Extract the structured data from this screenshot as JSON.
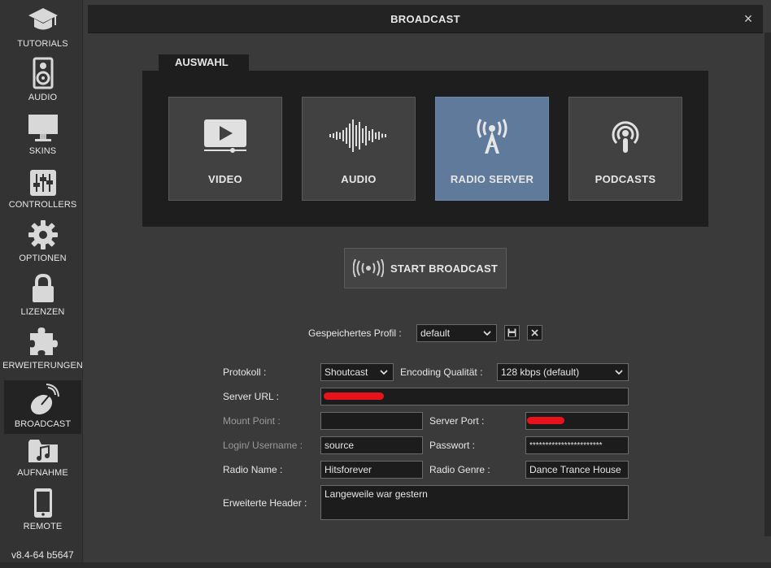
{
  "sidebar": {
    "items": [
      {
        "label": "TUTORIALS",
        "icon": "graduation-cap-icon"
      },
      {
        "label": "AUDIO",
        "icon": "speaker-icon"
      },
      {
        "label": "SKINS",
        "icon": "monitor-icon"
      },
      {
        "label": "CONTROLLERS",
        "icon": "mixer-sliders-icon"
      },
      {
        "label": "OPTIONEN",
        "icon": "gear-icon"
      },
      {
        "label": "LIZENZEN",
        "icon": "lock-icon"
      },
      {
        "label": "ERWEITERUNGEN",
        "icon": "puzzle-icon"
      },
      {
        "label": "BROADCAST",
        "icon": "satellite-dish-icon",
        "active": true
      },
      {
        "label": "AUFNAHME",
        "icon": "music-folder-icon"
      },
      {
        "label": "REMOTE",
        "icon": "phone-icon"
      }
    ],
    "version": "v8.4-64 b5647"
  },
  "dialog": {
    "title": "BROADCAST",
    "close": "×"
  },
  "auswahl": {
    "tab_label": "AUSWAHL",
    "tiles": [
      {
        "label": "VIDEO",
        "icon": "video-play-icon"
      },
      {
        "label": "AUDIO",
        "icon": "waveform-icon"
      },
      {
        "label": "RADIO SERVER",
        "icon": "radio-tower-icon",
        "active": true
      },
      {
        "label": "PODCASTS",
        "icon": "podcast-icon"
      }
    ]
  },
  "start_broadcast": {
    "label": "START BROADCAST",
    "icon": "broadcast-waves-icon"
  },
  "profile": {
    "label": "Gespeichertes Profil :",
    "value": "default",
    "save_icon": "floppy-disk-icon",
    "delete_icon": "close-icon"
  },
  "form": {
    "protokoll_label": "Protokoll :",
    "protokoll_value": "Shoutcast",
    "encoding_label": "Encoding Qualität :",
    "encoding_value": "128 kbps (default)",
    "server_url_label": "Server URL :",
    "server_url_value": "",
    "mount_point_label": "Mount Point :",
    "mount_point_value": "",
    "server_port_label": "Server Port :",
    "server_port_value": "",
    "login_label": "Login/ Username :",
    "login_value": "source",
    "password_label": "Passwort :",
    "password_value": "***********************",
    "radio_name_label": "Radio Name :",
    "radio_name_value": "Hitsforever",
    "radio_genre_label": "Radio Genre :",
    "radio_genre_value": "Dance Trance House",
    "header_label": "Erweiterte Header :",
    "header_value": "Langeweile war gestern"
  },
  "colors": {
    "active_tile": "#5f7a9a",
    "redaction": "#e8121d"
  }
}
